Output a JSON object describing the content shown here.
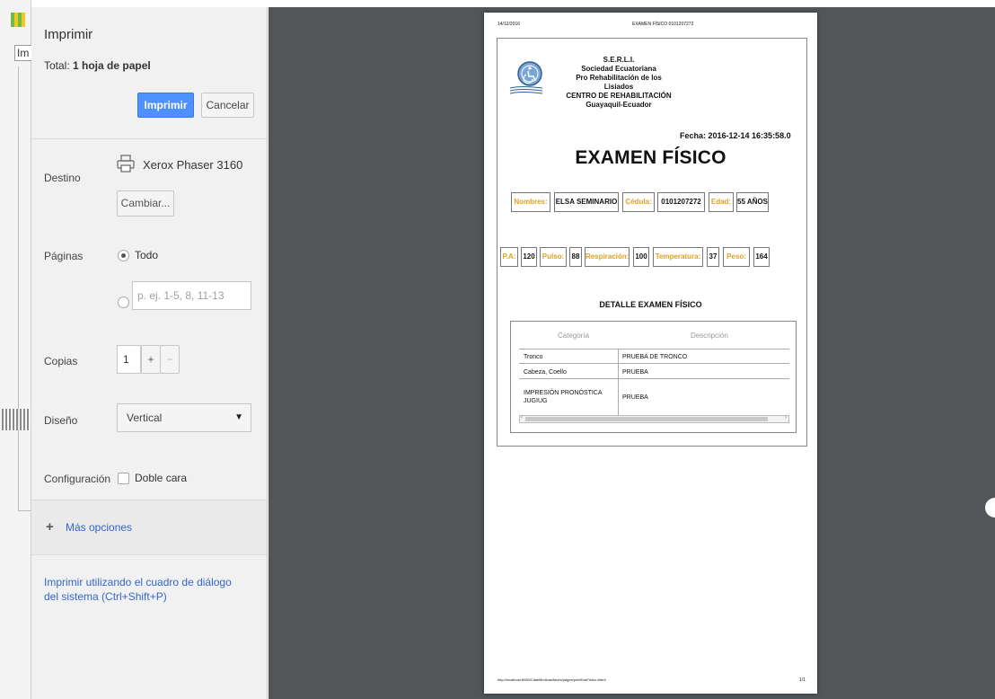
{
  "background_app": {
    "tab_label": "Im"
  },
  "panel": {
    "title": "Imprimir",
    "total_label": "Total: ",
    "total_value": "1 hoja de papel",
    "print_button": "Imprimir",
    "cancel_button": "Cancelar",
    "destination_label": "Destino",
    "printer_name": "Xerox Phaser 3160",
    "change_button": "Cambiar...",
    "pages_label": "Páginas",
    "pages_all": "Todo",
    "pages_placeholder": "p. ej. 1-5, 8, 11-13",
    "copies_label": "Copias",
    "copies_value": "1",
    "copies_plus": "+",
    "copies_minus": "−",
    "layout_label": "Diseño",
    "layout_value": "Vertical",
    "config_label": "Configuración",
    "duplex_label": "Doble cara",
    "more_options": "Más opciones",
    "system_dialog": "Imprimir utilizando el cuadro de diálogo del sistema (Ctrl+Shift+P)"
  },
  "preview_page": {
    "header_date": "14/12/2016",
    "header_title": "EXAMEN FÍSICO 0101207272",
    "org_lines": [
      "S.E.R.L.I.",
      "Sociedad Ecuatoriana",
      "Pro Rehabilitación de los Lisiados",
      "CENTRO DE REHABILITACIÓN",
      "Guayaquil-Ecuador"
    ],
    "date_line": "Fecha: 2016-12-14 16:35:58.0",
    "title": "EXAMEN FÍSICO",
    "patient": {
      "name_label": "Nombres:",
      "name_value": "ELSA SEMINARIO",
      "id_label": "Cédula:",
      "id_value": "0101207272",
      "age_label": "Edad:",
      "age_value": "55 AÑOS"
    },
    "vitals": {
      "pa_label": "P.A:",
      "pa_value": "120",
      "pulse_label": "Pulso:",
      "pulse_value": "88",
      "resp_label": "Respiración:",
      "resp_value": "100",
      "temp_label": "Temperatura:",
      "temp_value": "37",
      "weight_label": "Peso:",
      "weight_value": "164"
    },
    "detail_title": "DETALLE EXAMEN FÍSICO",
    "table": {
      "headers": [
        "Categoría",
        "Descripción"
      ],
      "rows": [
        {
          "category": "Tronco",
          "description": "PRUEBA DE TRONCO"
        },
        {
          "category": "Cabeza, Coello",
          "description": "PRUEBA"
        },
        {
          "category": "IMPRESIÓN PRONÓSTICA JUGIUG",
          "description": "PRUEBA"
        }
      ]
    },
    "footer_url": "http://localhost:8080/CitasMedicas/faces/pages/printExaFisico.xhtml",
    "footer_page": "1/1"
  },
  "colors": {
    "accent_blue": "#4d90fe",
    "link_blue": "#3366cc",
    "preview_bg": "#525659",
    "field_label_orange": "#e0a21c"
  }
}
